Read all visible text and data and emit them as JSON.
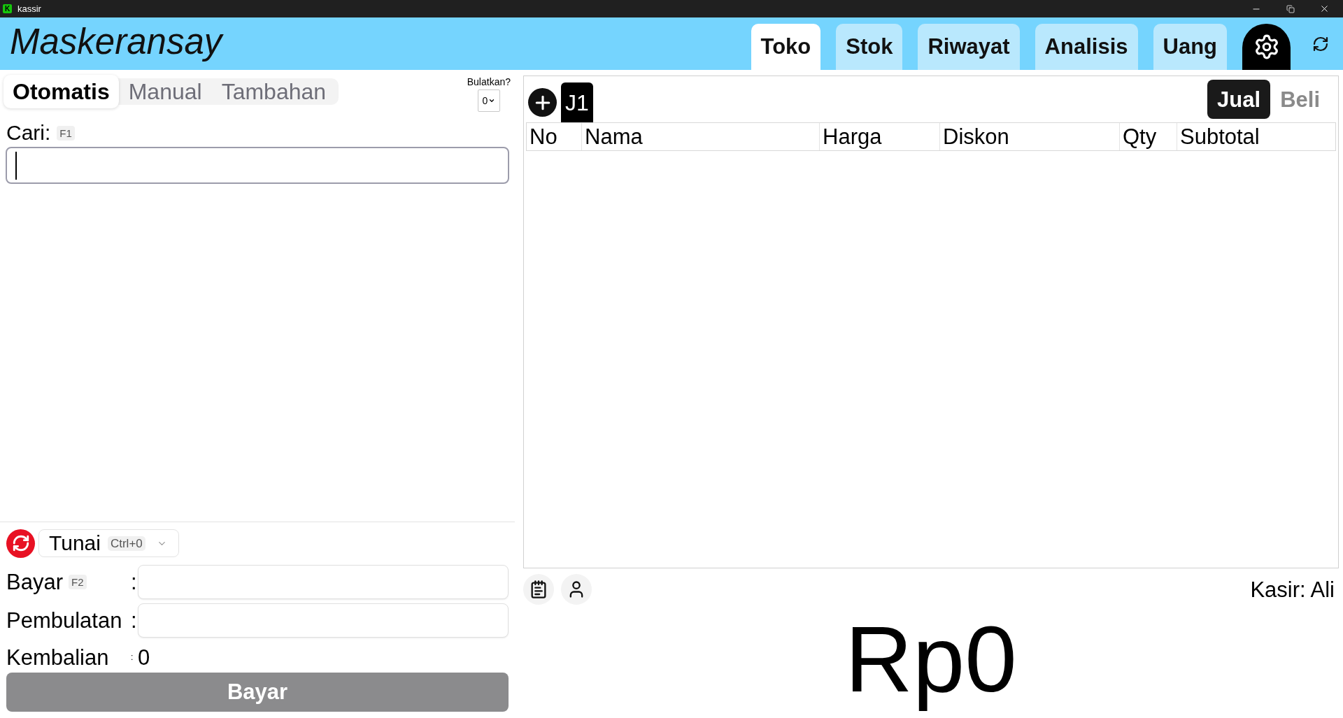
{
  "window": {
    "title": "kassir",
    "icon_letter": "K"
  },
  "header": {
    "logo": "Maskeransay",
    "tabs": [
      {
        "label": "Toko",
        "selected": true
      },
      {
        "label": "Stok",
        "selected": false
      },
      {
        "label": "Riwayat",
        "selected": false
      },
      {
        "label": "Analisis",
        "selected": false
      },
      {
        "label": "Uang",
        "selected": false
      }
    ]
  },
  "input_panel": {
    "modes": [
      {
        "label": "Otomatis",
        "selected": true
      },
      {
        "label": "Manual",
        "selected": false
      },
      {
        "label": "Tambahan",
        "selected": false
      }
    ],
    "rounding": {
      "label": "Bulatkan?",
      "value": "0"
    },
    "search": {
      "label": "Cari:",
      "shortcut": "F1",
      "focused": true
    }
  },
  "payment": {
    "method": {
      "label": "Tunai",
      "shortcut": "Ctrl+0"
    },
    "fields": [
      {
        "label": "Bayar",
        "shortcut": "F2",
        "separator": ":"
      },
      {
        "label": "Pembulatan",
        "separator": ":"
      }
    ],
    "change": {
      "label": "Kembalian",
      "separator": ":",
      "value": "0"
    },
    "pay_button": {
      "label": "Bayar",
      "disabled": true
    }
  },
  "cart": {
    "tabs": [
      {
        "label": "J1",
        "selected": true
      }
    ],
    "modes": [
      {
        "label": "Jual",
        "selected": true
      },
      {
        "label": "Beli",
        "selected": false
      }
    ],
    "table": {
      "columns": [
        "No",
        "Nama",
        "Harga",
        "Diskon",
        "Qty",
        "Subtotal"
      ]
    },
    "cashier": "Kasir: Ali",
    "total": "Rp0"
  }
}
